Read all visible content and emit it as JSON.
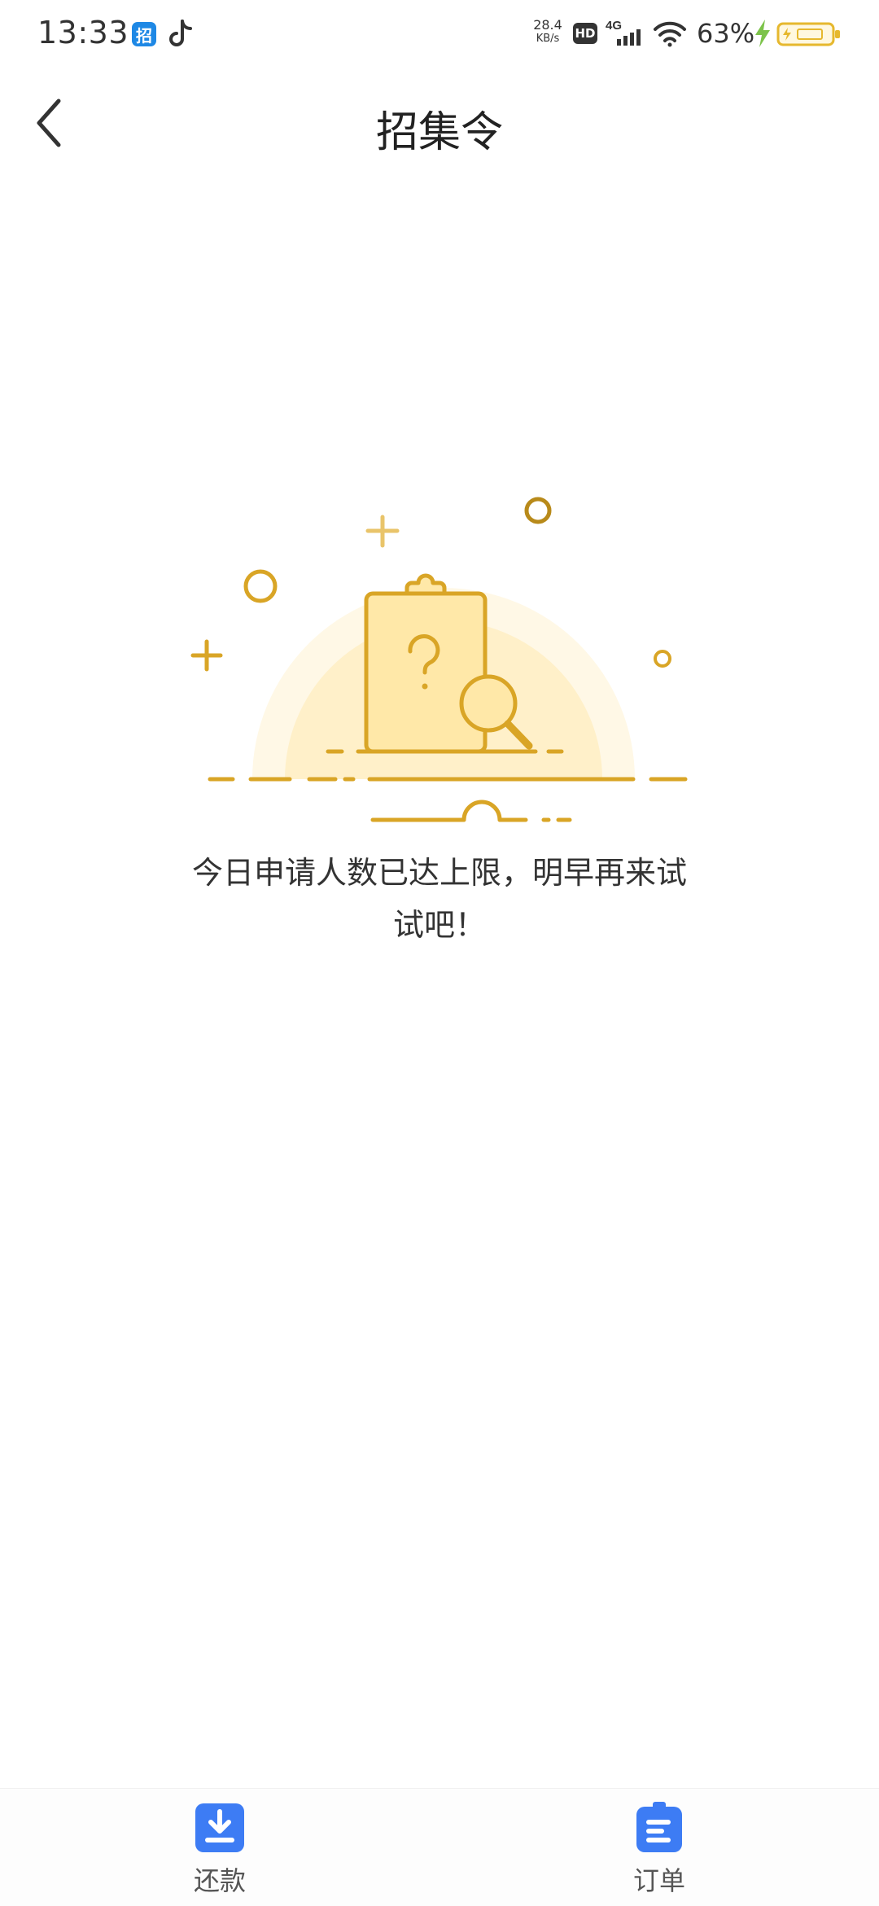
{
  "status_bar": {
    "time": "13:33",
    "app_icon_1": "招",
    "net_speed_value": "28.4",
    "net_speed_unit": "KB/s",
    "hd_label": "HD",
    "network_type": "4G",
    "battery_percent": "63%",
    "icons": [
      "zhao-app-icon",
      "tiktok-icon",
      "hd-icon",
      "signal-4g-icon",
      "wifi-icon",
      "charging-bolt-icon",
      "battery-icon"
    ]
  },
  "header": {
    "title": "招集令",
    "back_icon": "chevron-left-icon"
  },
  "empty_state": {
    "illustration_icon": "clipboard-search-icon",
    "message": "今日申请人数已达上限，明早再来试试吧！"
  },
  "tab_bar": {
    "items": [
      {
        "label": "还款",
        "icon": "download-tray-icon"
      },
      {
        "label": "订单",
        "icon": "clipboard-list-icon"
      }
    ]
  },
  "colors": {
    "accent_blue": "#3d7cf4",
    "illustration_gold": "#d9a526",
    "illustration_light": "#fff6dc"
  }
}
